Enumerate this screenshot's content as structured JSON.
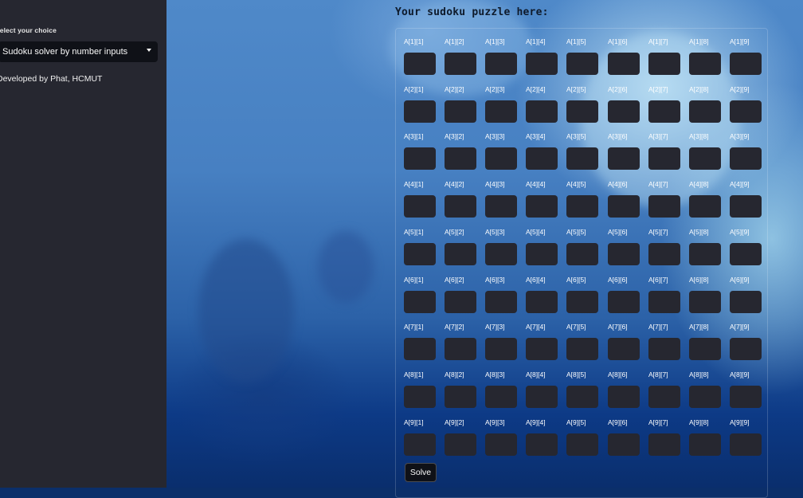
{
  "sidebar": {
    "choice_label": "Select your choice",
    "choice_value": "Sudoku solver by number inputs",
    "credit": "Developed by Phat, HCMUT"
  },
  "main": {
    "title": "Your sudoku puzzle here:",
    "solve_label": "Solve",
    "grid": {
      "labels": [
        [
          "A[1][1]",
          "A[1][2]",
          "A[1][3]",
          "A[1][4]",
          "A[1][5]",
          "A[1][6]",
          "A[1][7]",
          "A[1][8]",
          "A[1][9]"
        ],
        [
          "A[2][1]",
          "A[2][2]",
          "A[2][3]",
          "A[2][4]",
          "A[2][5]",
          "A[2][6]",
          "A[2][7]",
          "A[2][8]",
          "A[2][9]"
        ],
        [
          "A[3][1]",
          "A[3][2]",
          "A[3][3]",
          "A[3][4]",
          "A[3][5]",
          "A[3][6]",
          "A[3][7]",
          "A[3][8]",
          "A[3][9]"
        ],
        [
          "A[4][1]",
          "A[4][2]",
          "A[4][3]",
          "A[4][4]",
          "A[4][5]",
          "A[4][6]",
          "A[4][7]",
          "A[4][8]",
          "A[4][9]"
        ],
        [
          "A[5][1]",
          "A[5][2]",
          "A[5][3]",
          "A[5][4]",
          "A[5][5]",
          "A[5][6]",
          "A[5][7]",
          "A[5][8]",
          "A[5][9]"
        ],
        [
          "A[6][1]",
          "A[6][2]",
          "A[6][3]",
          "A[6][4]",
          "A[6][5]",
          "A[6][6]",
          "A[6][7]",
          "A[6][8]",
          "A[6][9]"
        ],
        [
          "A[7][1]",
          "A[7][2]",
          "A[7][3]",
          "A[7][4]",
          "A[7][5]",
          "A[7][6]",
          "A[7][7]",
          "A[7][8]",
          "A[7][9]"
        ],
        [
          "A[8][1]",
          "A[8][2]",
          "A[8][3]",
          "A[8][4]",
          "A[8][5]",
          "A[8][6]",
          "A[8][7]",
          "A[8][8]",
          "A[8][9]"
        ],
        [
          "A[9][1]",
          "A[9][2]",
          "A[9][3]",
          "A[9][4]",
          "A[9][5]",
          "A[9][6]",
          "A[9][7]",
          "A[9][8]",
          "A[9][9]"
        ]
      ],
      "values": [
        [
          "",
          "",
          "",
          "",
          "",
          "",
          "",
          "",
          ""
        ],
        [
          "",
          "",
          "",
          "",
          "",
          "",
          "",
          "",
          ""
        ],
        [
          "",
          "",
          "",
          "",
          "",
          "",
          "",
          "",
          ""
        ],
        [
          "",
          "",
          "",
          "",
          "",
          "",
          "",
          "",
          ""
        ],
        [
          "",
          "",
          "",
          "",
          "",
          "",
          "",
          "",
          ""
        ],
        [
          "",
          "",
          "",
          "",
          "",
          "",
          "",
          "",
          ""
        ],
        [
          "",
          "",
          "",
          "",
          "",
          "",
          "",
          "",
          ""
        ],
        [
          "",
          "",
          "",
          "",
          "",
          "",
          "",
          "",
          ""
        ],
        [
          "",
          "",
          "",
          "",
          "",
          "",
          "",
          "",
          ""
        ]
      ]
    }
  },
  "colors": {
    "sidebar_bg": "#262730",
    "input_bg": "#262730",
    "select_bg": "#0f1117",
    "title_color": "#0e1a2b"
  }
}
